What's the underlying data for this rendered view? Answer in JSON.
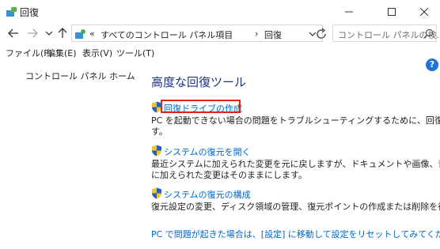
{
  "window": {
    "title": "回復"
  },
  "navbar": {
    "address_prefix": "«",
    "breadcrumb": [
      "すべてのコントロール パネル項目",
      "回復"
    ],
    "breadcrumb_separator": "›",
    "search_placeholder": "コントロール パネルの検..."
  },
  "menu": [
    "ファイル(F)",
    "編集(E)",
    "表示(V)",
    "ツール(T)"
  ],
  "sidebar": {
    "home_link": "コントロール パネル ホーム"
  },
  "main": {
    "heading": "高度な回復ツール",
    "tasks": [
      {
        "label": "回復ドライブの作成",
        "description_lines": [
          "PC を起動できない場合の問題をトラブルシューティングするために、回復ドライブを作成しま",
          "す。"
        ]
      },
      {
        "label": "システムの復元を開く",
        "description_lines": [
          "最近システムに加えられた変更を元に戻しますが、ドキュメントや画像、音楽などのファイル",
          "に加えられた変更はそのままにします。"
        ]
      },
      {
        "label": "システムの復元の構成",
        "description_lines": [
          "復元設定の変更、ディスク領域の管理、復元ポイントの作成または削除を行います。"
        ]
      }
    ],
    "bottom_link": "PC で問題が起きた場合は、[設定] に移動して設定をリセットしてみてください"
  },
  "help": {
    "symbol": "?"
  },
  "colors": {
    "link": "#0066cc",
    "heading": "#1e3287",
    "highlight_box": "#e0201a",
    "help": "#1e73d4"
  }
}
